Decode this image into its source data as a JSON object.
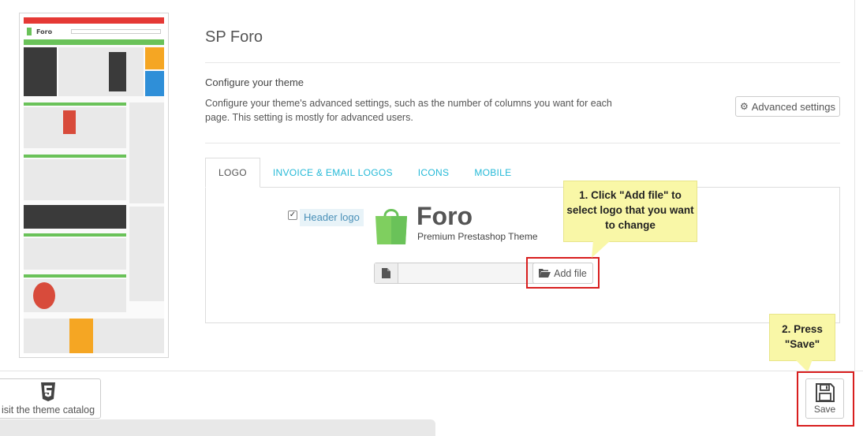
{
  "theme": {
    "title": "SP Foro",
    "configure_heading": "Configure your theme",
    "configure_description": "Configure your theme's advanced settings, such as the number of columns you want for each page. This setting is mostly for advanced users.",
    "advanced_settings_label": "Advanced settings"
  },
  "tabs": [
    {
      "label": "LOGO",
      "active": true
    },
    {
      "label": "INVOICE & EMAIL LOGOS",
      "active": false
    },
    {
      "label": "ICONS",
      "active": false
    },
    {
      "label": "MOBILE",
      "active": false
    }
  ],
  "logo": {
    "header_logo_label": "Header logo",
    "checked": true,
    "brand_name": "Foro",
    "brand_tagline": "Premium Prestashop Theme",
    "add_file_label": "Add file"
  },
  "callouts": {
    "add_file": "1. Click \"Add file\" to select logo that you want to change",
    "save": "2. Press \"Save\""
  },
  "footer": {
    "catalog_label": "isit the theme catalog",
    "save_label": "Save"
  },
  "icons": {
    "gear": "gear-icon",
    "file": "file-icon",
    "folder": "folder-open-icon",
    "html5": "html5-icon",
    "save": "floppy-disk-icon"
  },
  "colors": {
    "accent": "#25b9d7",
    "highlight": "#d81e1e",
    "callout": "#f9f7a7",
    "brand_green": "#6ac259"
  }
}
